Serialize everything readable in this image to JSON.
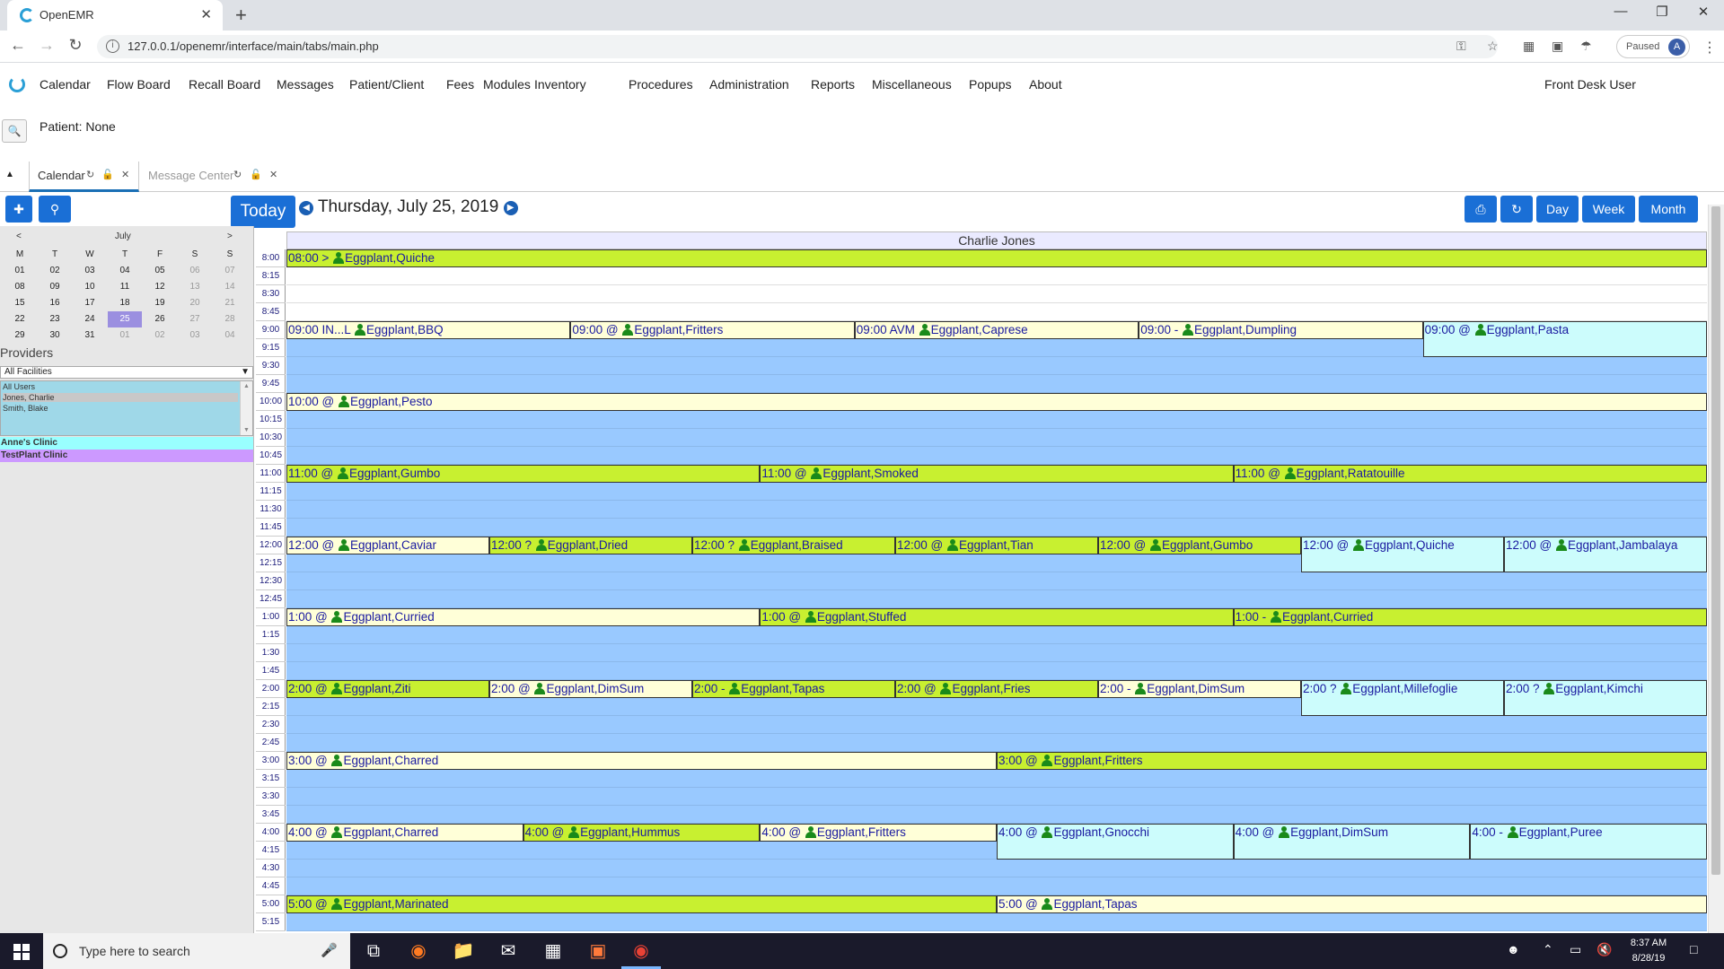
{
  "browser": {
    "tab_title": "OpenEMR",
    "new_tab": "+",
    "url": "127.0.0.1/openemr/interface/main/tabs/main.php",
    "profile_status": "Paused",
    "profile_initial": "A"
  },
  "app": {
    "menu": [
      "Calendar",
      "Flow Board",
      "Recall Board",
      "Messages",
      "Patient/Client",
      "Fees",
      "Modules",
      "Inventory",
      "Procedures",
      "Administration",
      "Reports",
      "Miscellaneous",
      "Popups",
      "About"
    ],
    "user": "Front Desk User",
    "patient": "Patient: None"
  },
  "tabs": {
    "calendar": "Calendar",
    "message_center": "Message Center"
  },
  "calendar": {
    "today_label": "Today",
    "date": "Thursday, July 25, 2019",
    "view_buttons": {
      "day": "Day",
      "week": "Week",
      "month": "Month"
    },
    "provider_column": "Charlie Jones"
  },
  "minical": {
    "month": "July",
    "prev": "<",
    "next": ">",
    "weekdays": [
      "M",
      "T",
      "W",
      "T",
      "F",
      "S",
      "S"
    ],
    "weeks": [
      [
        "01",
        "02",
        "03",
        "04",
        "05",
        "06",
        "07"
      ],
      [
        "08",
        "09",
        "10",
        "11",
        "12",
        "13",
        "14"
      ],
      [
        "15",
        "16",
        "17",
        "18",
        "19",
        "20",
        "21"
      ],
      [
        "22",
        "23",
        "24",
        "25",
        "26",
        "27",
        "28"
      ],
      [
        "29",
        "30",
        "31",
        "01",
        "02",
        "03",
        "04"
      ]
    ],
    "selected": "25"
  },
  "providers": {
    "label": "Providers",
    "facility": "All Facilities",
    "list": [
      "All Users",
      "Jones, Charlie",
      "Smith, Blake"
    ],
    "clinics": [
      {
        "name": "Anne's Clinic",
        "color": "#99ffff"
      },
      {
        "name": "TestPlant Clinic",
        "color": "#cc99ff"
      }
    ]
  },
  "times": [
    "8:00",
    "8:15",
    "8:30",
    "8:45",
    "9:00",
    "9:15",
    "9:30",
    "9:45",
    "10:00",
    "10:15",
    "10:30",
    "10:45",
    "11:00",
    "11:15",
    "11:30",
    "11:45",
    "12:00",
    "12:15",
    "12:30",
    "12:45",
    "1:00",
    "1:15",
    "1:30",
    "1:45",
    "2:00",
    "2:15",
    "2:30",
    "2:45",
    "3:00",
    "3:15",
    "3:30",
    "3:45",
    "4:00",
    "4:15",
    "4:30",
    "4:45",
    "5:00",
    "5:15"
  ],
  "colors": {
    "green": "#c8f030",
    "yellow": "#ffffd8",
    "cyan": "#ccfcfc",
    "blue_slot": "#99c9ff",
    "accent": "#1a6fd6"
  },
  "events": [
    {
      "slot": 0,
      "col": 0,
      "cols": 1,
      "text_pre": "08:00 > ",
      "text": "Eggplant,Quiche",
      "color": "green"
    },
    {
      "slot": 4,
      "col": 0,
      "cols": 5,
      "text_pre": "09:00 IN...L ",
      "text": "Eggplant,BBQ",
      "color": "yellow"
    },
    {
      "slot": 4,
      "col": 1,
      "cols": 5,
      "text_pre": "09:00 @ ",
      "text": "Eggplant,Fritters",
      "color": "yellow"
    },
    {
      "slot": 4,
      "col": 2,
      "cols": 5,
      "text_pre": "09:00 AVM ",
      "text": "Eggplant,Caprese",
      "color": "yellow"
    },
    {
      "slot": 4,
      "col": 3,
      "cols": 5,
      "text_pre": "09:00 - ",
      "text": "Eggplant,Dumpling",
      "color": "yellow"
    },
    {
      "slot": 4,
      "col": 4,
      "cols": 5,
      "text_pre": "09:00 @ ",
      "text": "Eggplant,Pasta",
      "color": "cyan",
      "tall": true
    },
    {
      "slot": 8,
      "col": 0,
      "cols": 1,
      "text_pre": "10:00 @ ",
      "text": "Eggplant,Pesto",
      "color": "yellow"
    },
    {
      "slot": 12,
      "col": 0,
      "cols": 3,
      "text_pre": "11:00 @ ",
      "text": "Eggplant,Gumbo",
      "color": "green"
    },
    {
      "slot": 12,
      "col": 1,
      "cols": 3,
      "text_pre": "11:00 @ ",
      "text": "Eggplant,Smoked",
      "color": "green"
    },
    {
      "slot": 12,
      "col": 2,
      "cols": 3,
      "text_pre": "11:00 @ ",
      "text": "Eggplant,Ratatouille",
      "color": "green"
    },
    {
      "slot": 16,
      "col": 0,
      "cols": 7,
      "text_pre": "12:00 @ ",
      "text": "Eggplant,Caviar",
      "color": "yellow"
    },
    {
      "slot": 16,
      "col": 1,
      "cols": 7,
      "text_pre": "12:00 ? ",
      "text": "Eggplant,Dried",
      "color": "green"
    },
    {
      "slot": 16,
      "col": 2,
      "cols": 7,
      "text_pre": "12:00 ? ",
      "text": "Eggplant,Braised",
      "color": "green"
    },
    {
      "slot": 16,
      "col": 3,
      "cols": 7,
      "text_pre": "12:00 @ ",
      "text": "Eggplant,Tian",
      "color": "green"
    },
    {
      "slot": 16,
      "col": 4,
      "cols": 7,
      "text_pre": "12:00 @ ",
      "text": "Eggplant,Gumbo",
      "color": "green"
    },
    {
      "slot": 16,
      "col": 5,
      "cols": 7,
      "text_pre": "12:00 @ ",
      "text": "Eggplant,Quiche",
      "color": "cyan",
      "tall": true
    },
    {
      "slot": 16,
      "col": 6,
      "cols": 7,
      "text_pre": "12:00 @ ",
      "text": "Eggplant,Jambalaya",
      "color": "cyan",
      "tall": true
    },
    {
      "slot": 20,
      "col": 0,
      "cols": 3,
      "text_pre": "1:00 @ ",
      "text": "Eggplant,Curried",
      "color": "yellow"
    },
    {
      "slot": 20,
      "col": 1,
      "cols": 3,
      "text_pre": "1:00 @ ",
      "text": "Eggplant,Stuffed",
      "color": "green"
    },
    {
      "slot": 20,
      "col": 2,
      "cols": 3,
      "text_pre": "1:00 - ",
      "text": "Eggplant,Curried",
      "color": "green"
    },
    {
      "slot": 24,
      "col": 0,
      "cols": 7,
      "text_pre": "2:00 @ ",
      "text": "Eggplant,Ziti",
      "color": "green"
    },
    {
      "slot": 24,
      "col": 1,
      "cols": 7,
      "text_pre": "2:00 @ ",
      "text": "Eggplant,DimSum",
      "color": "yellow"
    },
    {
      "slot": 24,
      "col": 2,
      "cols": 7,
      "text_pre": "2:00 - ",
      "text": "Eggplant,Tapas",
      "color": "green"
    },
    {
      "slot": 24,
      "col": 3,
      "cols": 7,
      "text_pre": "2:00 @ ",
      "text": "Eggplant,Fries",
      "color": "green"
    },
    {
      "slot": 24,
      "col": 4,
      "cols": 7,
      "text_pre": "2:00 - ",
      "text": "Eggplant,DimSum",
      "color": "yellow"
    },
    {
      "slot": 24,
      "col": 5,
      "cols": 7,
      "text_pre": "2:00 ? ",
      "text": "Eggplant,Millefoglie",
      "color": "cyan",
      "tall": true
    },
    {
      "slot": 24,
      "col": 6,
      "cols": 7,
      "text_pre": "2:00 ? ",
      "text": "Eggplant,Kimchi",
      "color": "cyan",
      "tall": true
    },
    {
      "slot": 28,
      "col": 0,
      "cols": 2,
      "text_pre": "3:00 @ ",
      "text": "Eggplant,Charred",
      "color": "yellow"
    },
    {
      "slot": 28,
      "col": 1,
      "cols": 2,
      "text_pre": "3:00 @ ",
      "text": "Eggplant,Fritters",
      "color": "green"
    },
    {
      "slot": 32,
      "col": 0,
      "cols": 6,
      "text_pre": "4:00 @ ",
      "text": "Eggplant,Charred",
      "color": "yellow"
    },
    {
      "slot": 32,
      "col": 1,
      "cols": 6,
      "text_pre": "4:00 @ ",
      "text": "Eggplant,Hummus",
      "color": "green"
    },
    {
      "slot": 32,
      "col": 2,
      "cols": 6,
      "text_pre": "4:00 @ ",
      "text": "Eggplant,Fritters",
      "color": "yellow"
    },
    {
      "slot": 32,
      "col": 3,
      "cols": 6,
      "text_pre": "4:00 @ ",
      "text": "Eggplant,Gnocchi",
      "color": "cyan",
      "tall": true
    },
    {
      "slot": 32,
      "col": 4,
      "cols": 6,
      "text_pre": "4:00 @ ",
      "text": "Eggplant,DimSum",
      "color": "cyan",
      "tall": true
    },
    {
      "slot": 32,
      "col": 5,
      "cols": 6,
      "text_pre": "4:00 - ",
      "text": "Eggplant,Puree",
      "color": "cyan",
      "tall": true
    },
    {
      "slot": 36,
      "col": 0,
      "cols": 2,
      "text_pre": "5:00 @ ",
      "text": "Eggplant,Marinated",
      "color": "green"
    },
    {
      "slot": 36,
      "col": 1,
      "cols": 2,
      "text_pre": "5:00 @ ",
      "text": "Eggplant,Tapas",
      "color": "yellow"
    }
  ],
  "blue_slots": [
    5,
    6,
    7,
    9,
    10,
    11,
    13,
    14,
    15,
    17,
    18,
    19,
    21,
    22,
    23,
    25,
    26,
    27,
    29,
    30,
    31,
    33,
    34,
    35,
    37
  ],
  "taskbar": {
    "search_placeholder": "Type here to search",
    "time": "8:37 AM",
    "date": "8/28/19"
  }
}
